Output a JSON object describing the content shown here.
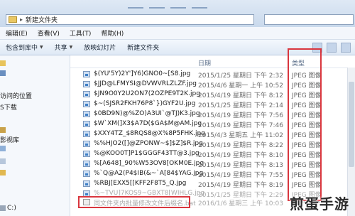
{
  "address": {
    "path": "新建文件夹",
    "chevron": "▸"
  },
  "menu": {
    "items": [
      "编辑(E)",
      "查看(V)",
      "工具(T)",
      "帮助(H)"
    ]
  },
  "toolbar": {
    "include_library": "包含到库中",
    "share": "共享",
    "slideshow": "放映幻灯片",
    "new_folder": "新建文件夹"
  },
  "nav": {
    "items": [
      {
        "label": ""
      },
      {
        "label": ""
      },
      {
        "label": "访问的位置"
      },
      {
        "label": "S下载"
      },
      {
        "label": ""
      },
      {
        "label": "影视库"
      },
      {
        "label": ""
      },
      {
        "label": ""
      },
      {
        "label": ""
      },
      {
        "label": "C:)"
      }
    ]
  },
  "columns": {
    "date": "日期",
    "type": "类型"
  },
  "files": [
    {
      "name": "$(YU'5Y)2Y']Y6)GNO0~[S8.jpg",
      "date": "2015/1/25 星期日 下午 2:32",
      "type": "JPEG 图像"
    },
    {
      "name": "$JJD@LFMYSI@DVWVRLZLZF.jpg",
      "date": "2015/4/6 星期一 上午 10:52",
      "type": "JPEG 图像"
    },
    {
      "name": "$JN9O0Y2U2ON7(2OZPE9T2K.jpg",
      "date": "2015/4/19 星期日 下午 8:12",
      "type": "JPEG 图像"
    },
    {
      "name": "$~(SJSR2FKH76P8`})GYF2U.jpg",
      "date": "2015/1/25 星期日 下午 2:14",
      "type": "JPEG 图像"
    },
    {
      "name": "$0BD9N)@%ZO)A3UI`@TJ)K3.jpg",
      "date": "2015/4/19 星期日 下午 7:56",
      "type": "JPEG 图像"
    },
    {
      "name": "$W`XM(]X3$A7D($GA$M@AM.jpg",
      "date": "2015/4/19 星期日 下午 7:46",
      "type": "JPEG 图像"
    },
    {
      "name": "$XXY4TZ_$8RQS8@X%8P5FHK.jpg",
      "date": "2015/4/3 星期五 上午 11:02",
      "type": "JPEG 图像"
    },
    {
      "name": "%%HJO2([]@ZPONW~$]$Z]$R.jpg",
      "date": "2015/4/19 星期日 下午 8:22",
      "type": "JPEG 图像"
    },
    {
      "name": "%@KOO0T]P1$GGGF43TT@3.jpg",
      "date": "2015/4/19 星期日 下午 8:10",
      "type": "JPEG 图像"
    },
    {
      "name": "%[A648]_90%W53OV8[OKM0E.jpg",
      "date": "2015/4/19 星期日 下午 8:13",
      "type": "JPEG 图像"
    },
    {
      "name": "%`Q@A2(P4$IB(&~`A[84$YAG.jpg",
      "date": "2015/4/19 星期日 下午 7:55",
      "type": "JPEG 图像"
    },
    {
      "name": "%RBJ[EXX5[[KFF2F8T5_Q.jpg",
      "date": "2015/4/19 星期日 下午 8:19",
      "type": "JPEG 图像"
    },
    {
      "name": "%~TVU]7KOS9~GBXT8[WIHLG.jpg",
      "date": "2015/1/25 星期日 下午 2:29",
      "type": "JPEG 图像"
    }
  ],
  "bat_file": {
    "name": "同文件夹内批量修改文件后缀名.bat",
    "date": "2016/1/6 星期三 上午 10:03",
    "type": "Windows"
  },
  "watermark": "煎蛋手游",
  "colors": {
    "highlight": "#d9363e",
    "accent": "#3f7fc6"
  }
}
